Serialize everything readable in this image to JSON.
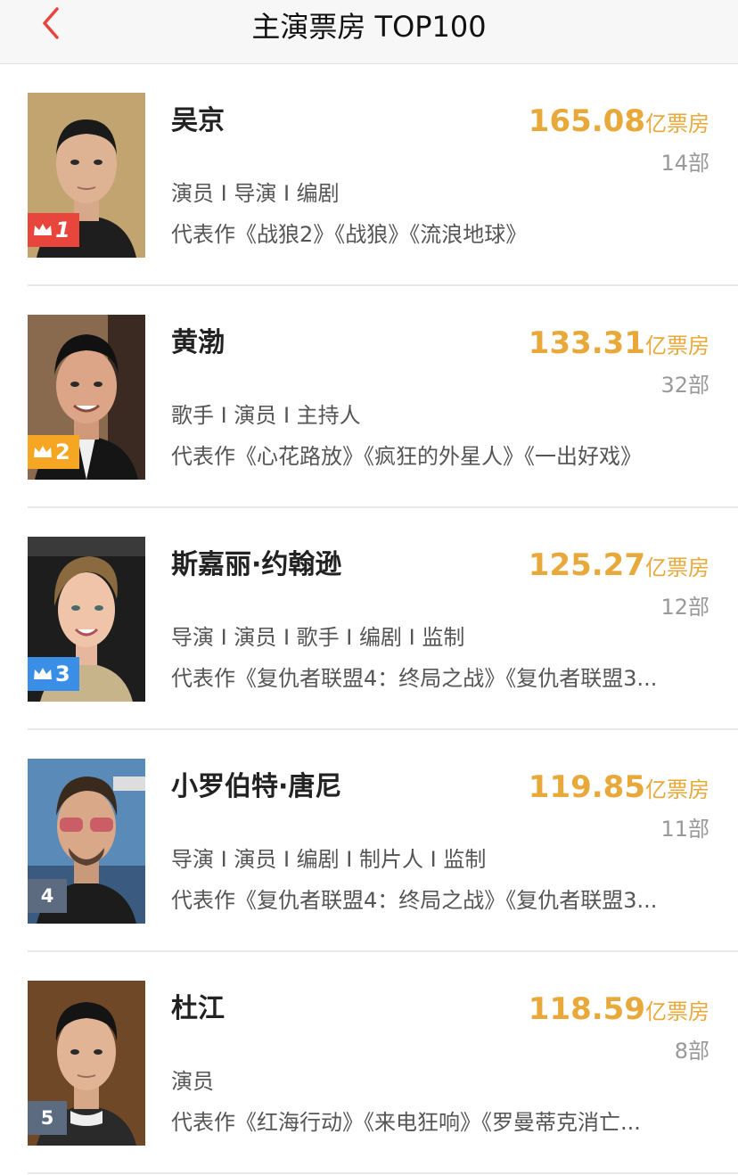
{
  "header": {
    "title": "主演票房 TOP100",
    "back_icon": "chevron-left-icon",
    "accent": "#e8453c"
  },
  "colors": {
    "boxoffice": "#e8a93a",
    "rank1": "#e8453c",
    "rank2": "#f5a623",
    "rank3": "#3a8ee6",
    "rank_other": "#5c6b80"
  },
  "actors": [
    {
      "rank": "1",
      "name": "吴京",
      "boxoffice": "165.08",
      "unit": "亿票房",
      "count": "14部",
      "roles": "演员 I 导演 I 编剧",
      "works": "代表作《战狼2》《战狼》《流浪地球》"
    },
    {
      "rank": "2",
      "name": "黄渤",
      "boxoffice": "133.31",
      "unit": "亿票房",
      "count": "32部",
      "roles": "歌手 I 演员 I 主持人",
      "works": "代表作《心花路放》《疯狂的外星人》《一出好戏》"
    },
    {
      "rank": "3",
      "name": "斯嘉丽·约翰逊",
      "boxoffice": "125.27",
      "unit": "亿票房",
      "count": "12部",
      "roles": "导演 I 演员 I 歌手 I 编剧 I 监制",
      "works": "代表作《复仇者联盟4：终局之战》《复仇者联盟3..."
    },
    {
      "rank": "4",
      "name": "小罗伯特·唐尼",
      "boxoffice": "119.85",
      "unit": "亿票房",
      "count": "11部",
      "roles": "导演 I 演员 I 编剧 I 制片人 I 监制",
      "works": "代表作《复仇者联盟4：终局之战》《复仇者联盟3..."
    },
    {
      "rank": "5",
      "name": "杜江",
      "boxoffice": "118.59",
      "unit": "亿票房",
      "count": "8部",
      "roles": "演员",
      "works": "代表作《红海行动》《来电狂响》《罗曼蒂克消亡..."
    }
  ]
}
